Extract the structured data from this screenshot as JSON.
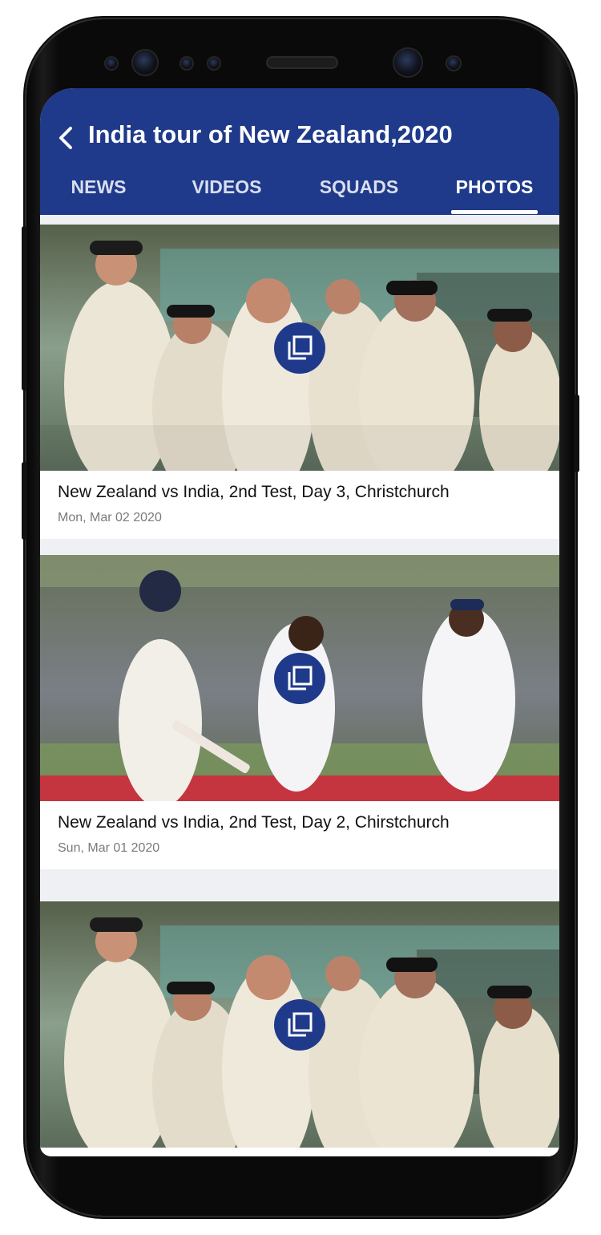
{
  "header": {
    "title": "India tour of New Zealand,2020",
    "back_icon": "back-arrow-icon"
  },
  "tabs": [
    {
      "label": "NEWS",
      "active": false
    },
    {
      "label": "VIDEOS",
      "active": false
    },
    {
      "label": "SQUADS",
      "active": false
    },
    {
      "label": "PHOTOS",
      "active": true
    }
  ],
  "gallery": [
    {
      "title": "New Zealand vs India, 2nd Test, Day 3, Christchurch",
      "date": "Mon, Mar 02 2020",
      "icon": "gallery-icon"
    },
    {
      "title": "New Zealand vs India, 2nd Test, Day 2, Chirstchurch",
      "date": "Sun, Mar 01 2020",
      "icon": "gallery-icon"
    },
    {
      "title": "",
      "date": "",
      "icon": "gallery-icon"
    }
  ],
  "colors": {
    "primary": "#1f3a8a",
    "background": "#eef0f4",
    "card": "#ffffff",
    "date_text": "#7a7a7a"
  }
}
